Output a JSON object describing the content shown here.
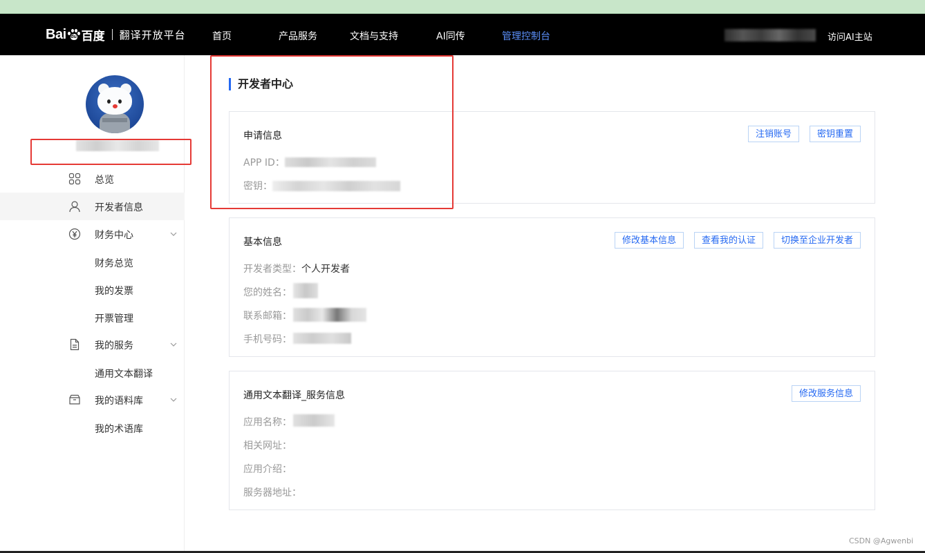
{
  "navbar": {
    "logo_bai": "Bai",
    "logo_du": "du",
    "logo_baidu_cn": "百度",
    "logo_platform": "翻译开放平台",
    "items": [
      "首页",
      "产品服务",
      "文档与支持",
      "AI同传",
      "管理控制台"
    ],
    "active_item": "管理控制台",
    "visit_link": "访问AI主站"
  },
  "sidebar": {
    "menu": {
      "overview": "总览",
      "developer_info": "开发者信息",
      "finance_center": "财务中心",
      "finance_overview": "财务总览",
      "my_invoices": "我的发票",
      "invoice_management": "开票管理",
      "my_services": "我的服务",
      "general_text_translation": "通用文本翻译",
      "my_corpus": "我的语料库",
      "my_terminology": "我的术语库"
    }
  },
  "main": {
    "title": "开发者中心",
    "application_card": {
      "title": "申请信息",
      "cancel_account_btn": "注销账号",
      "reset_key_btn": "密钥重置",
      "app_id_label": "APP ID：",
      "secret_label": "密钥："
    },
    "basic_card": {
      "title": "基本信息",
      "edit_basic_btn": "修改基本信息",
      "view_cert_btn": "查看我的认证",
      "switch_enterprise_btn": "切换至企业开发者",
      "dev_type_label": "开发者类型：",
      "dev_type_value": "个人开发者",
      "name_label": "您的姓名：",
      "email_label": "联系邮箱：",
      "phone_label": "手机号码："
    },
    "service_card": {
      "title": "通用文本翻译_服务信息",
      "edit_service_btn": "修改服务信息",
      "app_name_label": "应用名称：",
      "related_url_label": "相关网址：",
      "app_intro_label": "应用介绍：",
      "server_addr_label": "服务器地址："
    }
  },
  "watermark": "CSDN @Agwenbi",
  "colors": {
    "accent": "#2468f2",
    "nav_active": "#5b8ff9",
    "highlight_red": "#e53935",
    "navbar_bg": "#000000",
    "top_strip": "#c8e6c9"
  }
}
